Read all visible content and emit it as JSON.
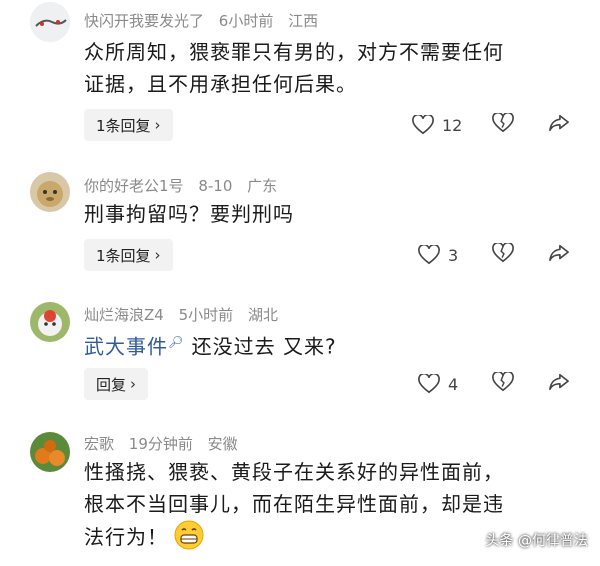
{
  "comments": [
    {
      "username": "快闪开我要发光了",
      "time": "6小时前",
      "location": "江西",
      "text_lines": [
        "众所周知，猥亵罪只有男的，对方不需要任何",
        "证据，且不用承担任何后果。"
      ],
      "reply_label": "1条回复",
      "like_count": "12"
    },
    {
      "username": "你的好老公1号",
      "time": "8-10",
      "location": "广东",
      "text_lines": [
        "刑事拘留吗？要判刑吗"
      ],
      "reply_label": "1条回复",
      "like_count": "3"
    },
    {
      "username": "灿烂海浪Z4",
      "time": "5小时前",
      "location": "湖北",
      "link_text": "武大事件",
      "text_after_link": " 还没过去 又来?",
      "reply_label": "回复",
      "like_count": "4"
    },
    {
      "username": "宏歌",
      "time": "19分钟前",
      "location": "安徽",
      "text_lines": [
        "性搔挠、猥亵、黄段子在关系好的异性面前，",
        "根本不当回事儿，而在陌生异性面前，却是违",
        "法行为！"
      ]
    }
  ],
  "watermark": "头条 @何律普法",
  "icons": {
    "chevron": "›",
    "like": "heart-outline-icon",
    "dislike": "broken-heart-icon",
    "share": "share-arrow-icon"
  }
}
